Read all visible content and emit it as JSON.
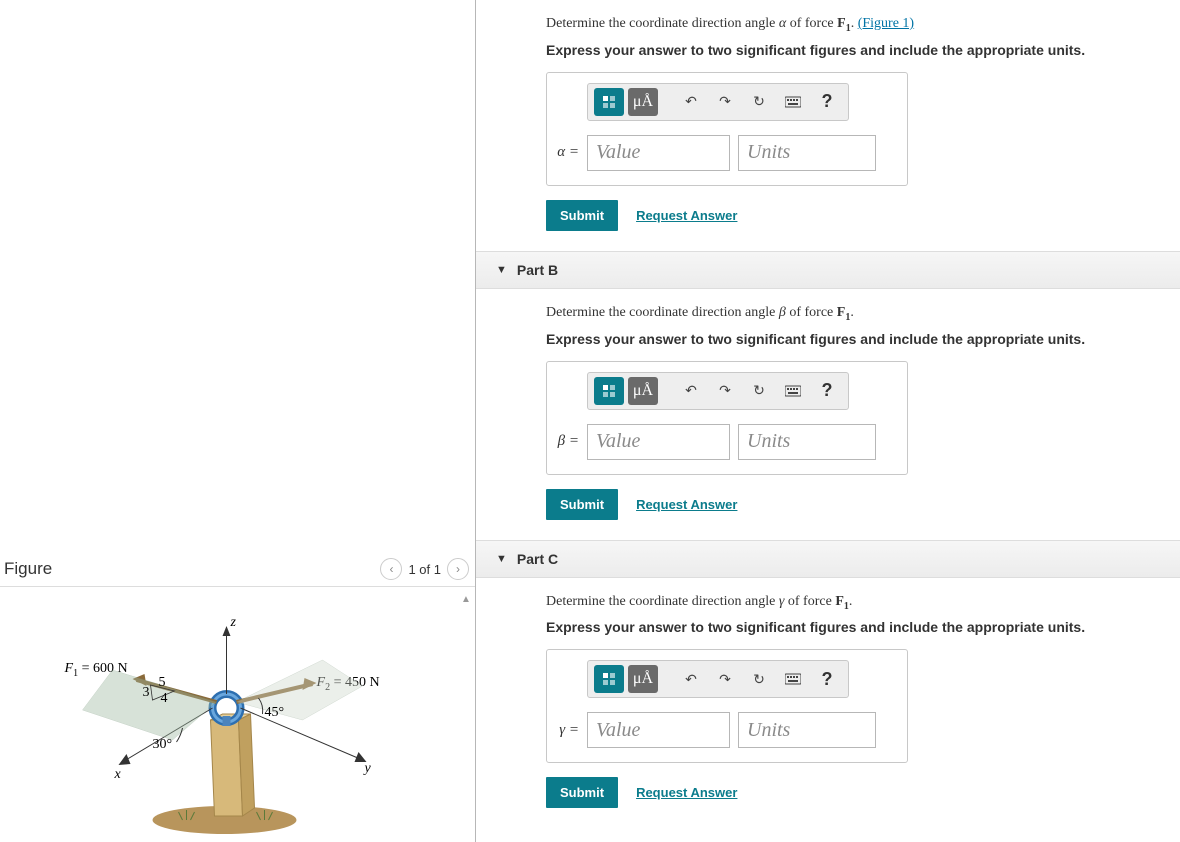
{
  "figure": {
    "title": "Figure",
    "pager_text": "1 of 1",
    "labels": {
      "z": "z",
      "y": "y",
      "x": "x",
      "f1": "F₁ = 600 N",
      "f2": "F₂ = 450 N",
      "ang45": "45°",
      "ang30": "30°",
      "ratio_a": "5",
      "ratio_b": "4",
      "ratio_c": "3"
    }
  },
  "toolbar": {
    "templates_tip": "Templates",
    "symbols_tip": "μÅ",
    "undo_tip": "Undo",
    "redo_tip": "Redo",
    "reset_tip": "Reset",
    "keyboard_tip": "Keyboard",
    "help_tip": "?"
  },
  "common": {
    "submit": "Submit",
    "request_answer": "Request Answer",
    "value_ph": "Value",
    "units_ph": "Units",
    "instruction": "Express your answer to two significant figures and include the appropriate units."
  },
  "parts": {
    "a": {
      "prompt_pre": "Determine the coordinate direction angle ",
      "prompt_sym": "α",
      "prompt_mid": " of force ",
      "prompt_force": "F",
      "prompt_sub": "1",
      "prompt_post": ". ",
      "figure_link": "(Figure 1)",
      "eq_label": "α ="
    },
    "b": {
      "title": "Part B",
      "prompt_pre": "Determine the coordinate direction angle ",
      "prompt_sym": "β",
      "prompt_mid": " of force ",
      "prompt_force": "F",
      "prompt_sub": "1",
      "prompt_post": ".",
      "eq_label": "β ="
    },
    "c": {
      "title": "Part C",
      "prompt_pre": "Determine the coordinate direction angle ",
      "prompt_sym": "γ",
      "prompt_mid": " of force ",
      "prompt_force": "F",
      "prompt_sub": "1",
      "prompt_post": ".",
      "eq_label": "γ ="
    }
  }
}
